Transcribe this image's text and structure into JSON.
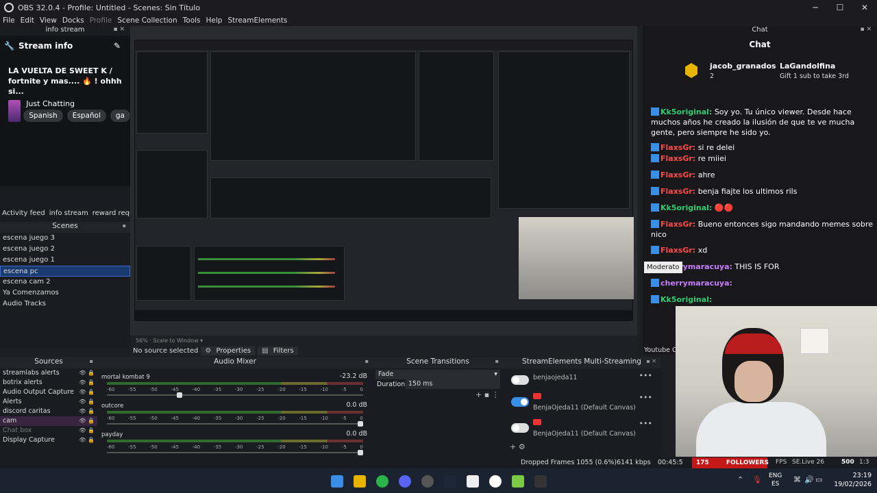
{
  "window": {
    "title": "OBS 32.0.4 - Profile: Untitled - Scenes: Sin Título"
  },
  "menu": [
    "File",
    "Edit",
    "View",
    "Docks",
    "Profile",
    "Scene Collection",
    "Tools",
    "Help",
    "StreamElements"
  ],
  "left_dock": {
    "header": "info stream",
    "stream_info_title": "Stream info",
    "stream_title": "LA VUELTA DE SWEET K / fortnite y mas.... 🔥 ! ohhh si...",
    "category": "Just Chatting",
    "tags": [
      "Spanish",
      "Español",
      "ga"
    ],
    "tabs": [
      "Activity feed",
      "info stream",
      "reward request"
    ]
  },
  "scenes": {
    "header": "Scenes",
    "items": [
      "escena juego 3",
      "escena juego 2",
      "escena juego 1",
      "escena pc",
      "escena cam 2",
      "Ya Comenzamos",
      "Audio Tracks"
    ],
    "selected": "escena pc"
  },
  "preview_footer": {
    "zoom": "56%",
    "scale": "Scale to Window"
  },
  "context_bar": {
    "no_source": "No source selected",
    "properties": "Properties",
    "filters": "Filters"
  },
  "sources": {
    "header": "Sources",
    "items": [
      "streamlabs alerts",
      "botrix alerts",
      "Audio Output Capture",
      "Alerts",
      "discord caritas",
      "cam",
      "Chat box",
      "Display Capture"
    ]
  },
  "audio_mixer": {
    "header": "Audio Mixer",
    "channels": [
      {
        "name": "mortal kombat 9",
        "db": "-23.2 dB",
        "level": 0.28
      },
      {
        "name": "outcore",
        "db": "0.0 dB",
        "level": 1.0
      },
      {
        "name": "payday",
        "db": "0.0 dB",
        "level": 1.0
      }
    ],
    "ticks": [
      "-60",
      "-55",
      "-50",
      "-45",
      "-40",
      "-35",
      "-30",
      "-25",
      "-20",
      "-15",
      "-10",
      "-5",
      "0"
    ]
  },
  "transitions": {
    "header": "Scene Transitions",
    "type": "Fade",
    "duration_label": "Duration",
    "duration": "150 ms"
  },
  "se_multistream": {
    "header": "StreamElements Multi-Streaming",
    "rows": [
      {
        "name": "benjaojeda11",
        "on": false
      },
      {
        "name": "BenjaOjeda11 (Default Canvas)",
        "on": true
      },
      {
        "name": "BenjaOjeda11 (Default Canvas)",
        "on": false
      }
    ]
  },
  "chat": {
    "dock_header": "Chat",
    "title": "Chat",
    "pinned": {
      "user": "jacob_granados",
      "count": "2",
      "user2": "LaGandolfina",
      "count2": "1",
      "gift": "Gift 1 sub to take 3rd"
    },
    "messages": [
      {
        "user": "Kk5original:",
        "text": "Soy yo. Tu único viewer. Desde hace muchos años he creado la ilusión de que te ve mucha gente, pero siempre he sido yo.",
        "color": "#2ecc71"
      },
      {
        "user": "FlaxsGr:",
        "text": "si re delei",
        "color": "#ff4a4a"
      },
      {
        "user": "FlaxsGr:",
        "text": "re miiei",
        "color": "#ff4a4a"
      },
      {
        "user": "FlaxsGr:",
        "text": "ahre",
        "color": "#ff4a4a"
      },
      {
        "user": "FlaxsGr:",
        "text": "benja fiajte los ultimos rils",
        "color": "#ff4a4a"
      },
      {
        "user": "Kk5original:",
        "text": "🔴🔴",
        "color": "#2ecc71"
      },
      {
        "user": "FlaxsGr:",
        "text": "Bueno entonces sigo mandando memes sobre nico",
        "color": "#ff4a4a"
      },
      {
        "user": "FlaxsGr:",
        "text": "xd",
        "color": "#ff4a4a"
      },
      {
        "user": "cherrymaracuya:",
        "text": "THIS IS FOR",
        "color": "#c77dff"
      },
      {
        "user": "cherrymaracuya:",
        "text": "",
        "color": "#c77dff"
      },
      {
        "user": "Kk5original:",
        "text": "",
        "color": "#2ecc71"
      }
    ],
    "moderator_label": "Moderato",
    "youtube_label": "Youtube Ch"
  },
  "status": {
    "dropped": "Dropped Frames 1055 (0.6%)",
    "kbps": "6141 kbps",
    "time": "00:45:5",
    "followers_count": "175",
    "followers_label": "FOLLOWERS",
    "fps": "FPS",
    "se_live": "SE.Live 26",
    "se_count": "500",
    "stat_total": "1:3"
  },
  "taskbar": {
    "lang1": "ENG",
    "lang2": "ES",
    "time": "23:19",
    "date": "19/02/2026"
  },
  "colors": {
    "accent": "#3c6ccf",
    "twitch": "#9146ff",
    "youtube": "#e33333"
  }
}
